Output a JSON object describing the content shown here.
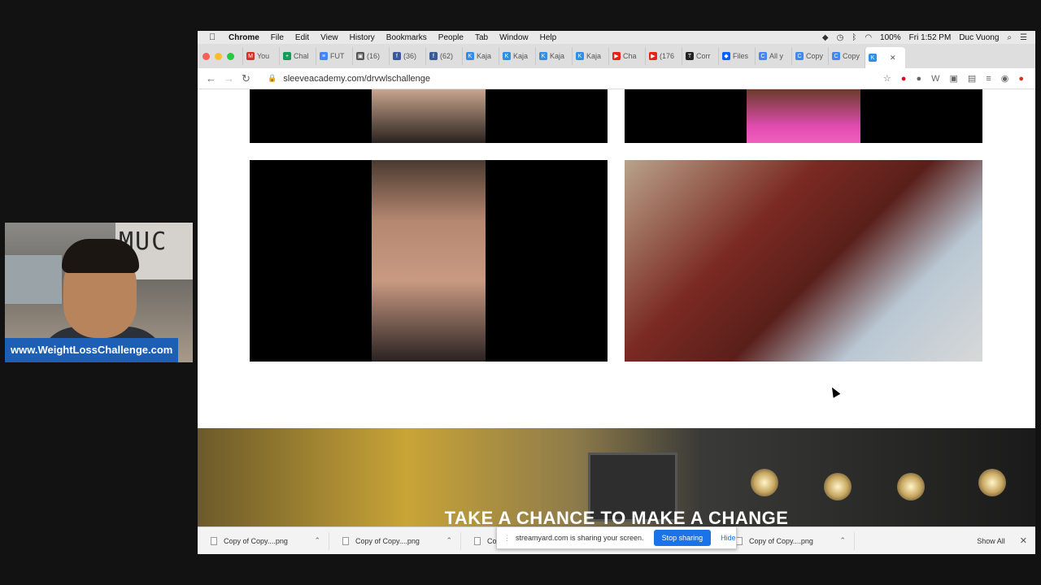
{
  "webcam": {
    "wall_text": "MUC",
    "caption": "www.WeightLossChallenge.com"
  },
  "menubar": {
    "app": "Chrome",
    "items": [
      "File",
      "Edit",
      "View",
      "History",
      "Bookmarks",
      "People",
      "Tab",
      "Window",
      "Help"
    ],
    "battery": "100%",
    "clock": "Fri 1:52 PM",
    "user": "Duc Vuong"
  },
  "tabs": [
    {
      "label": "You",
      "icon": "gmail-icon",
      "color": "#d93025",
      "glyph": "M"
    },
    {
      "label": "Chal",
      "icon": "sheets-icon",
      "color": "#0f9d58",
      "glyph": "+"
    },
    {
      "label": "FUT",
      "icon": "docs-icon",
      "color": "#4285f4",
      "glyph": "≡"
    },
    {
      "label": "(16)",
      "icon": "image-icon",
      "color": "#555555",
      "glyph": "▣"
    },
    {
      "label": "(36)",
      "icon": "facebook-icon",
      "color": "#3b5998",
      "glyph": "f"
    },
    {
      "label": "(62)",
      "icon": "facebook-icon",
      "color": "#3b5998",
      "glyph": "f"
    },
    {
      "label": "Kaja",
      "icon": "kajabi-icon",
      "color": "#2f8ee6",
      "glyph": "K"
    },
    {
      "label": "Kaja",
      "icon": "kajabi-icon",
      "color": "#2f8ee6",
      "glyph": "K"
    },
    {
      "label": "Kaja",
      "icon": "kajabi-icon",
      "color": "#2f8ee6",
      "glyph": "K"
    },
    {
      "label": "Kaja",
      "icon": "kajabi-icon",
      "color": "#2f8ee6",
      "glyph": "K"
    },
    {
      "label": "Cha",
      "icon": "youtube-icon",
      "color": "#e62117",
      "glyph": "▶"
    },
    {
      "label": "(176",
      "icon": "youtube-icon",
      "color": "#e62117",
      "glyph": "▶"
    },
    {
      "label": "Corr",
      "icon": "nyt-icon",
      "color": "#222222",
      "glyph": "T"
    },
    {
      "label": "Files",
      "icon": "dropbox-icon",
      "color": "#0061fe",
      "glyph": "◆"
    },
    {
      "label": "All y",
      "icon": "chrome-icon",
      "color": "#4285f4",
      "glyph": "C"
    },
    {
      "label": "Copy",
      "icon": "chrome-icon",
      "color": "#4285f4",
      "glyph": "C"
    },
    {
      "label": "Copy",
      "icon": "chrome-icon",
      "color": "#4285f4",
      "glyph": "C"
    },
    {
      "label": "",
      "icon": "kajabi-icon",
      "color": "#2f8ee6",
      "glyph": "K",
      "active": true
    }
  ],
  "address": {
    "url": "sleeveacademy.com/drvwlschallenge"
  },
  "banner": {
    "title": "TAKE A CHANCE TO MAKE A CHANGE"
  },
  "downloads": {
    "items": [
      "Copy of Copy....png",
      "Copy of Copy....png",
      "Co",
      "Copy of Copy....png"
    ],
    "show_all": "Show All"
  },
  "share_bar": {
    "message": "streamyard.com is sharing your screen.",
    "stop": "Stop sharing",
    "hide": "Hide"
  }
}
